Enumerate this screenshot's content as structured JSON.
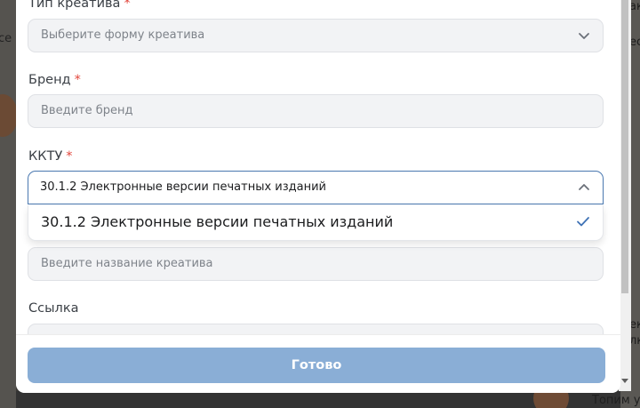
{
  "background": {
    "left_fragment": "се",
    "right_fragments": [
      "ак",
      "ес",
      "ек",
      "лк"
    ],
    "bottom_right_fragment": "Топим у"
  },
  "form": {
    "creative_type": {
      "label": "Тип креатива",
      "required_mark": "*",
      "placeholder": "Выберите форму креатива",
      "icon": "chevron-down-icon"
    },
    "brand": {
      "label": "Бренд",
      "required_mark": "*",
      "placeholder": "Введите бренд"
    },
    "kktu": {
      "label": "ККТУ",
      "required_mark": "*",
      "value": "30.1.2 Электронные версии печатных изданий",
      "icon": "chevron-up-icon",
      "options": [
        {
          "label": "30.1.2 Электронные версии печатных изданий",
          "selected": true
        }
      ]
    },
    "creative_name": {
      "placeholder": "Введите название креатива"
    },
    "link": {
      "label": "Ссылка"
    }
  },
  "footer": {
    "submit_label": "Готово"
  },
  "colors": {
    "accent": "#4a78b0",
    "required": "#e2453b",
    "submit_disabled": "#8aaed6"
  }
}
